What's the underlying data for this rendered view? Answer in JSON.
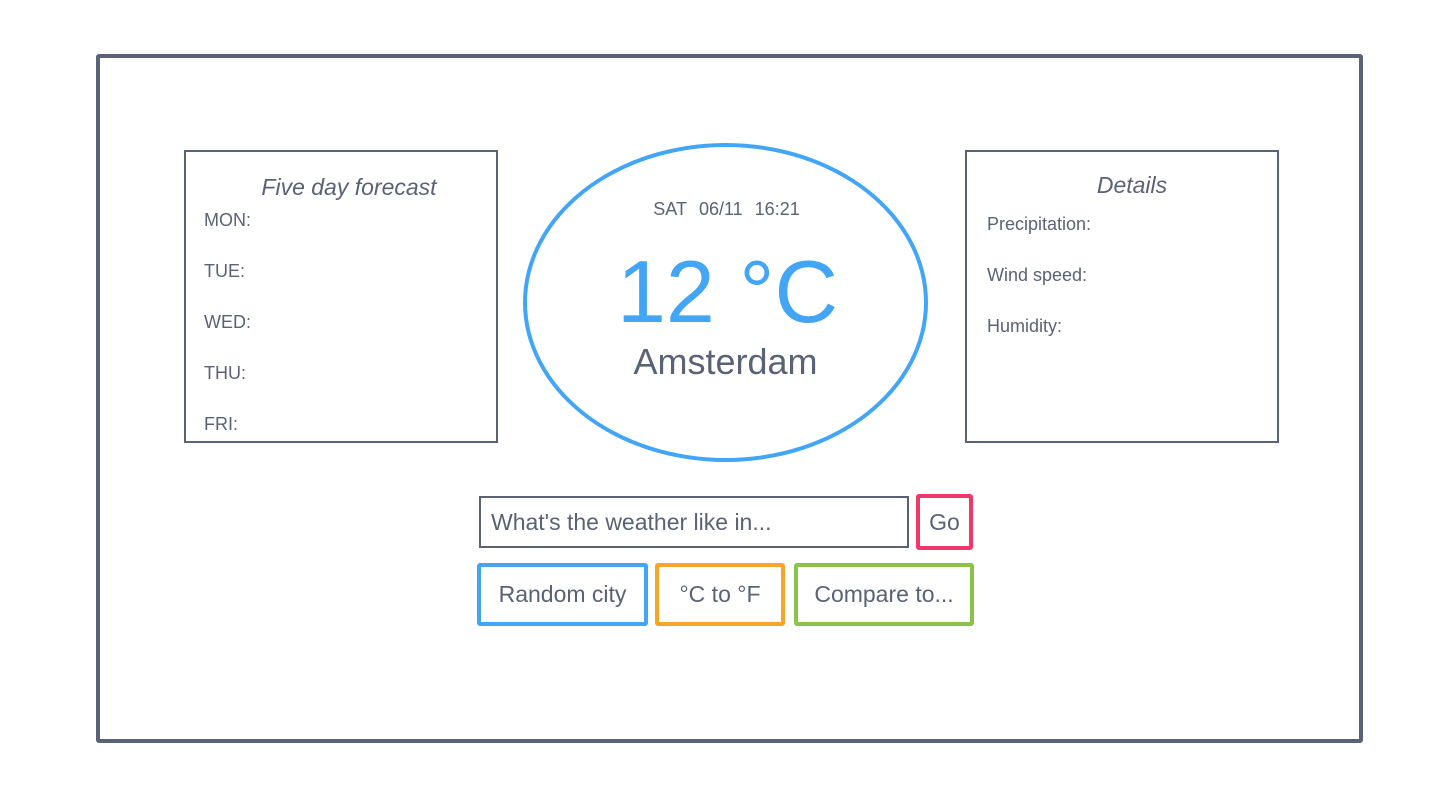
{
  "forecast": {
    "title": "Five day forecast",
    "days": [
      "MON:",
      "TUE:",
      "WED:",
      "THU:",
      "FRI:"
    ]
  },
  "current": {
    "day": "SAT",
    "date": "06/11",
    "time": "16:21",
    "temperature": "12 °C",
    "city": "Amsterdam"
  },
  "details": {
    "title": "Details",
    "items": [
      "Precipitation:",
      "Wind speed:",
      "Humidity:"
    ]
  },
  "search": {
    "placeholder": "What's the weather like in...",
    "go_label": "Go"
  },
  "actions": {
    "random_label": "Random city",
    "convert_label": "°C to °F",
    "compare_label": "Compare to..."
  },
  "colors": {
    "outline": "#5a6275",
    "accent_blue": "#42a5f5",
    "go_pink": "#f0376a",
    "convert_orange": "#f7a62c",
    "compare_green": "#8bc34a"
  }
}
